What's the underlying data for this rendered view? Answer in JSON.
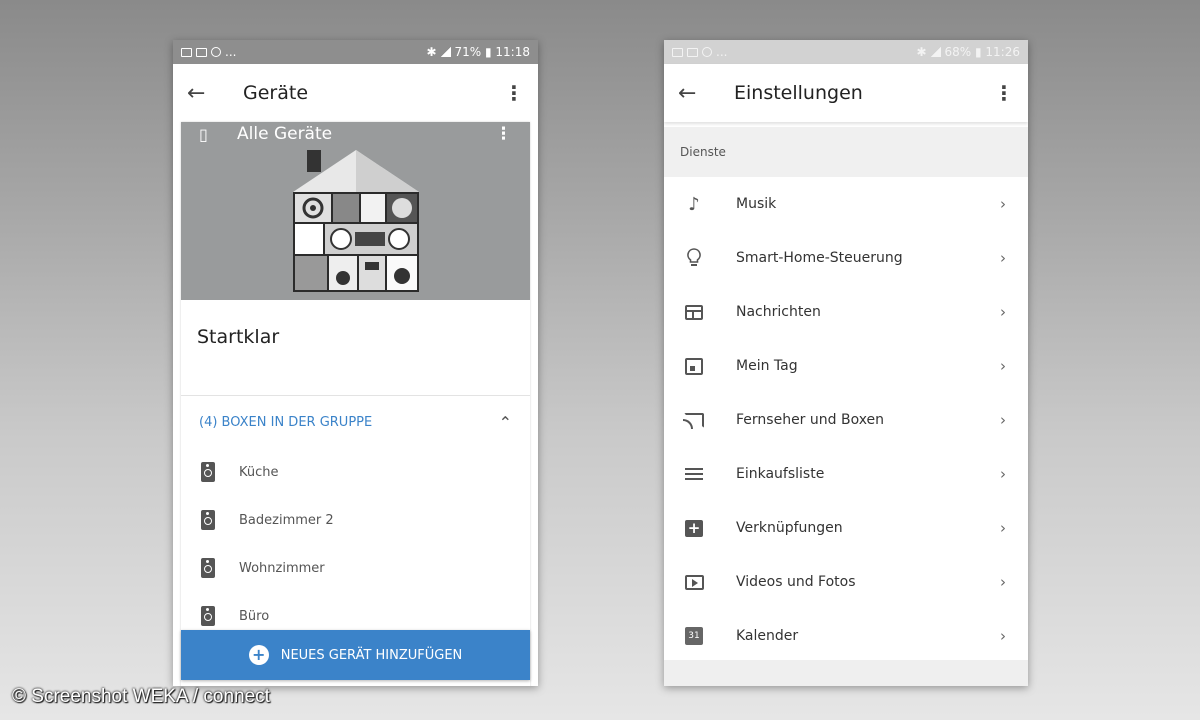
{
  "left_phone": {
    "status": {
      "left": "...",
      "right": "71% ▮ 11:18"
    },
    "appbar": {
      "back": "←",
      "title": "Geräte",
      "more": "⋮"
    },
    "hero": {
      "label": "Alle Geräte",
      "more": "⋮"
    },
    "status_title": "Startklar",
    "group": {
      "label": "(4) BOXEN IN DER GRUPPE",
      "chevron": "⌃"
    },
    "speakers": [
      {
        "name": "Küche"
      },
      {
        "name": "Badezimmer 2"
      },
      {
        "name": "Wohnzimmer"
      },
      {
        "name": "Büro"
      }
    ],
    "add_button": {
      "icon": "+",
      "label": "NEUES GERÄT HINZUFÜGEN"
    }
  },
  "right_phone": {
    "status": {
      "left": "...",
      "right": "68% ▮ 11:26"
    },
    "appbar": {
      "back": "←",
      "title": "Einstellungen",
      "more": "⋮"
    },
    "section": "Dienste",
    "items": [
      {
        "label": "Musik",
        "icon": "music-note-icon",
        "glyph": "♪"
      },
      {
        "label": "Smart-Home-Steuerung",
        "icon": "lightbulb-icon",
        "glyph": "💡"
      },
      {
        "label": "Nachrichten",
        "icon": "news-icon"
      },
      {
        "label": "Mein Tag",
        "icon": "calendar-day-icon"
      },
      {
        "label": "Fernseher und Boxen",
        "icon": "cast-icon"
      },
      {
        "label": "Einkaufsliste",
        "icon": "list-icon"
      },
      {
        "label": "Verknüpfungen",
        "icon": "add-shortcut-icon",
        "glyph": "+"
      },
      {
        "label": "Videos und Fotos",
        "icon": "video-icon"
      },
      {
        "label": "Kalender",
        "icon": "calendar-icon",
        "glyph": "31"
      }
    ],
    "chevron": "›"
  },
  "watermark": "© Screenshot WEKA / connect",
  "colors": {
    "accent": "#3b83c9",
    "hero_bg": "#999b9c"
  }
}
